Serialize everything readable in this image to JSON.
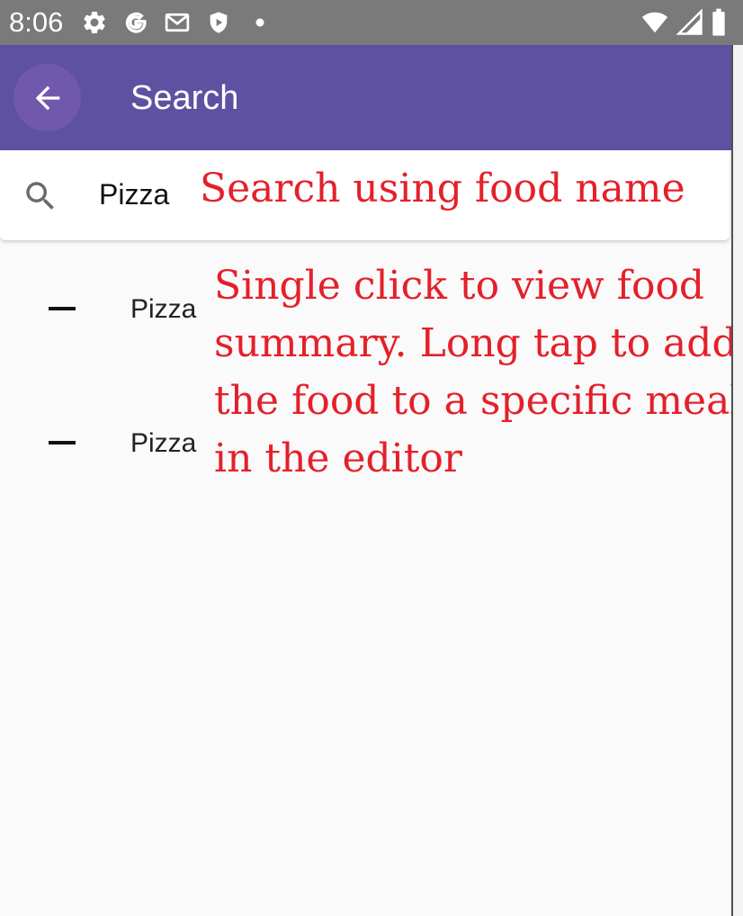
{
  "status_bar": {
    "time": "8:06",
    "icons_left": [
      "gear-icon",
      "google-g-icon",
      "gmail-icon",
      "shield-icon",
      "dot-icon"
    ],
    "icons_right": [
      "wifi-icon",
      "signal-icon",
      "battery-icon"
    ]
  },
  "toolbar": {
    "title": "Search",
    "background": "#5e51a1",
    "back_icon": "arrow-left-icon"
  },
  "search": {
    "value": "Pizza",
    "icon": "search-icon"
  },
  "results": [
    {
      "label": "Pizza",
      "icon": "dash-icon"
    },
    {
      "label": "Pizza",
      "icon": "dash-icon"
    }
  ],
  "annotations": {
    "search_hint": "Search using food name",
    "list_hint_lines": [
      "Single click to view food",
      "summary. Long tap to add",
      "the food to a specific meal",
      "in the editor"
    ],
    "color": "#e4202a"
  }
}
